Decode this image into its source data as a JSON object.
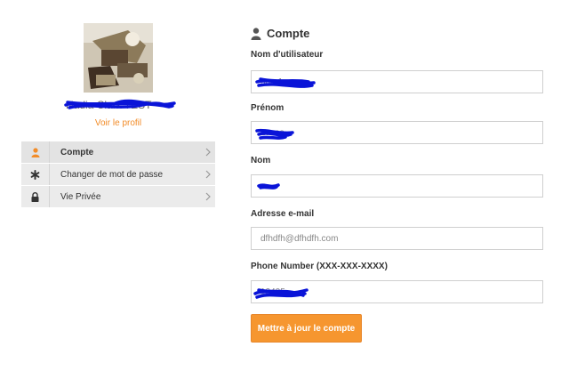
{
  "profile": {
    "username": "Nadia Clark TEST",
    "view_profile": "Voir le profil"
  },
  "menu": [
    {
      "label": "Compte",
      "icon": "user-icon",
      "active": true
    },
    {
      "label": "Changer de mot de passe",
      "icon": "asterisk-icon",
      "active": false
    },
    {
      "label": "Vie Privée",
      "icon": "lock-icon",
      "active": false
    }
  ],
  "form": {
    "title": "Compte",
    "fields": {
      "username": {
        "label": "Nom d'utilisateur",
        "value": "nom1"
      },
      "firstname": {
        "label": "Prénom",
        "value": "Lucas"
      },
      "lastname": {
        "label": "Nom",
        "value": ""
      },
      "email": {
        "label": "Adresse e-mail",
        "value": "dfhdfh@dfhdfh.com"
      },
      "phone": {
        "label": "Phone Number (XXX-XXX-XXXX)",
        "value": "12405"
      }
    },
    "submit_label": "Mettre à jour le compte"
  },
  "colors": {
    "accent": "#f6962f",
    "link": "#f28c28",
    "redaction": "#0a14d8"
  }
}
